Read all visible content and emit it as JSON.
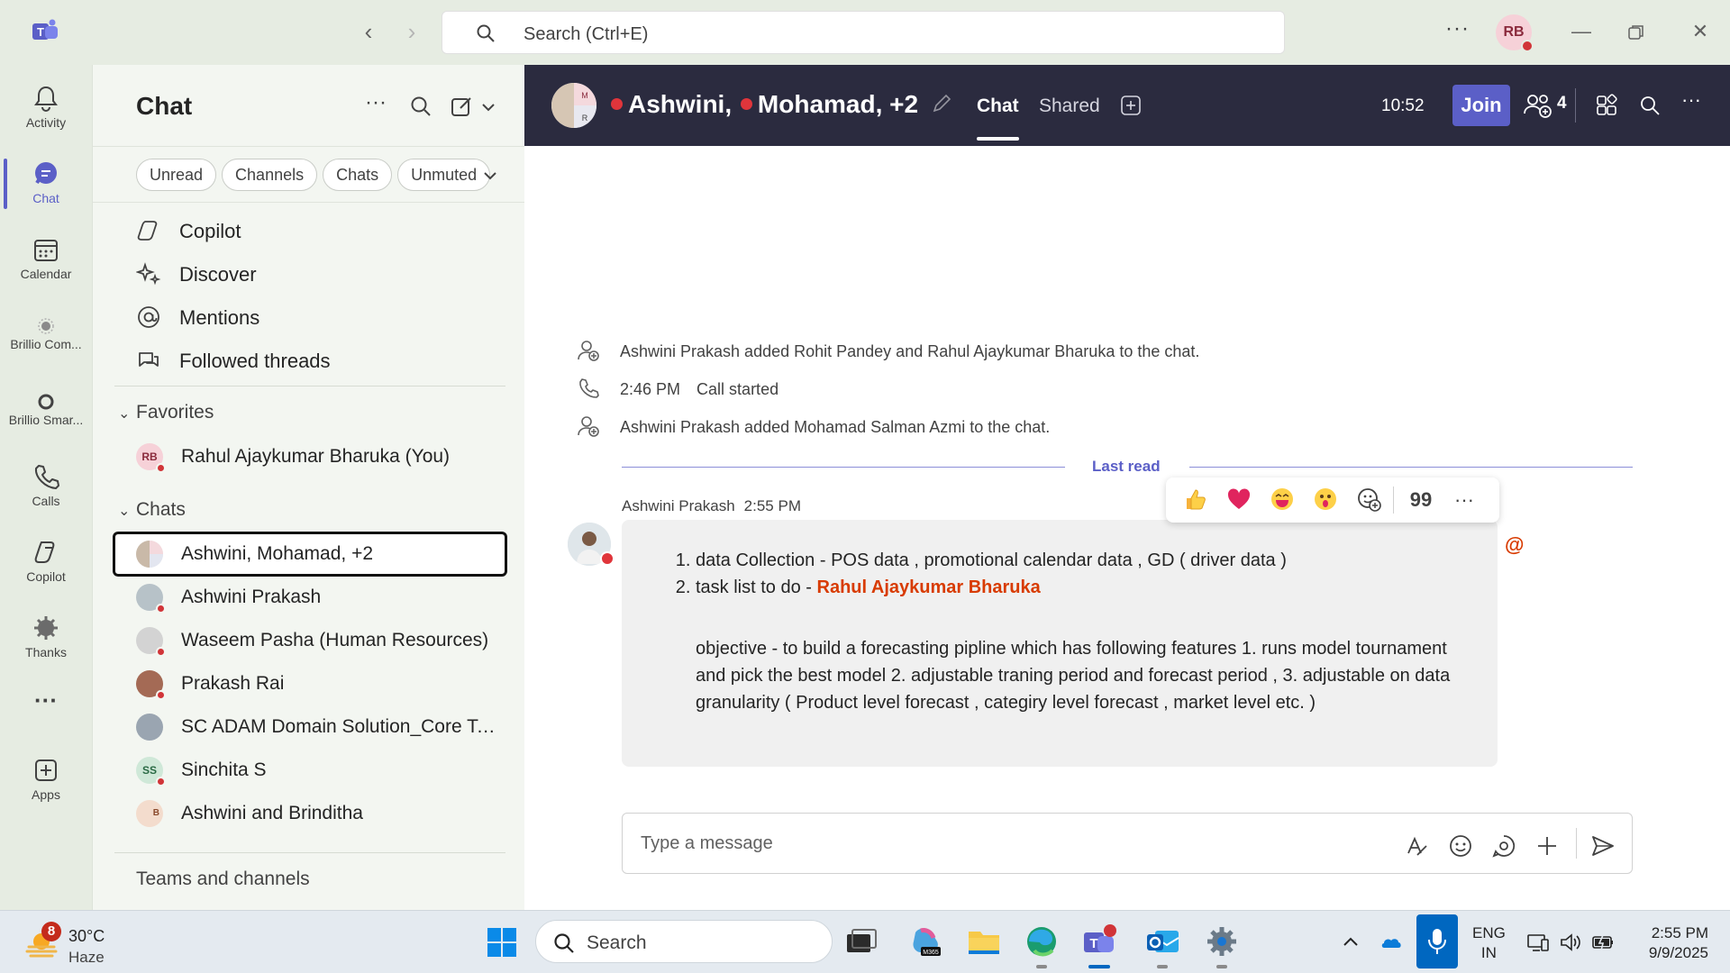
{
  "titlebar": {
    "search_placeholder": "Search (Ctrl+E)",
    "more": "···",
    "user_initials": "RB"
  },
  "rail": {
    "items": [
      {
        "label": "Activity",
        "icon": "bell-icon"
      },
      {
        "label": "Chat",
        "icon": "chat-icon"
      },
      {
        "label": "Calendar",
        "icon": "calendar-icon"
      },
      {
        "label": "Brillio Com...",
        "icon": "app-icon"
      },
      {
        "label": "Brillio Smar...",
        "icon": "app-icon"
      },
      {
        "label": "Calls",
        "icon": "phone-icon"
      },
      {
        "label": "Copilot",
        "icon": "copilot-icon"
      },
      {
        "label": "Thanks",
        "icon": "thanks-icon"
      },
      {
        "label": "···",
        "icon": "more-icon"
      },
      {
        "label": "Apps",
        "icon": "apps-icon"
      }
    ]
  },
  "pane": {
    "title": "Chat",
    "filters": [
      "Unread",
      "Channels",
      "Chats",
      "Unmuted"
    ],
    "nav": [
      {
        "label": "Copilot"
      },
      {
        "label": "Discover"
      },
      {
        "label": "Mentions"
      },
      {
        "label": "Followed threads"
      }
    ],
    "favorites_label": "Favorites",
    "favorites": [
      {
        "name": "Rahul Ajaykumar Bharuka (You)",
        "initials": "RB"
      }
    ],
    "chats_label": "Chats",
    "chats": [
      {
        "name": "Ashwini, Mohamad, +2",
        "initials": ""
      },
      {
        "name": "Ashwini Prakash",
        "initials": ""
      },
      {
        "name": "Waseem Pasha (Human Resources)",
        "initials": ""
      },
      {
        "name": "Prakash Rai",
        "initials": ""
      },
      {
        "name": "SC ADAM Domain Solution_Core Tea...",
        "initials": ""
      },
      {
        "name": "Sinchita S",
        "initials": "SS"
      },
      {
        "name": "Ashwini and Brinditha",
        "initials": "B"
      }
    ],
    "teams_channels": "Teams and channels"
  },
  "header": {
    "name1": "Ashwini,",
    "name2": "Mohamad, +2",
    "tab_chat": "Chat",
    "tab_shared": "Shared",
    "time": "10:52",
    "join": "Join",
    "people_count": "4",
    "group_initials": [
      "M",
      "R"
    ]
  },
  "system_messages": [
    {
      "time": "",
      "text": "Ashwini Prakash added Rohit Pandey and Rahul Ajaykumar Bharuka to the chat."
    },
    {
      "time": "2:46 PM",
      "text": "Call started"
    },
    {
      "time": "",
      "text": "Ashwini Prakash added Mohamad Salman Azmi to the chat."
    }
  ],
  "last_read": "Last read",
  "message": {
    "author": "Ashwini Prakash",
    "time": "2:55 PM",
    "item1": "data Collection - POS data , promotional calendar data , GD ( driver data )",
    "item2_prefix": "task list to do - ",
    "item2_mention": "Rahul Ajaykumar Bharuka",
    "objective": "objective - to build a forecasting pipline which has following features 1. runs model tournament and pick the best model 2. adjustable traning period and forecast period , 3. adjustable on data granularity ( Product level forecast , categiry level forecast , market level etc. )",
    "at_symbol": "@"
  },
  "reactions": [
    "👍",
    "❤️",
    "😆",
    "😮",
    "add-reaction",
    "99",
    "···"
  ],
  "composer": {
    "placeholder": "Type a message"
  },
  "taskbar": {
    "weather_badge": "8",
    "weather_temp": "30°C",
    "weather_desc": "Haze",
    "search_label": "Search",
    "lang_line1": "ENG",
    "lang_line2": "IN",
    "clock_time": "2:55 PM",
    "clock_date": "9/9/2025"
  }
}
